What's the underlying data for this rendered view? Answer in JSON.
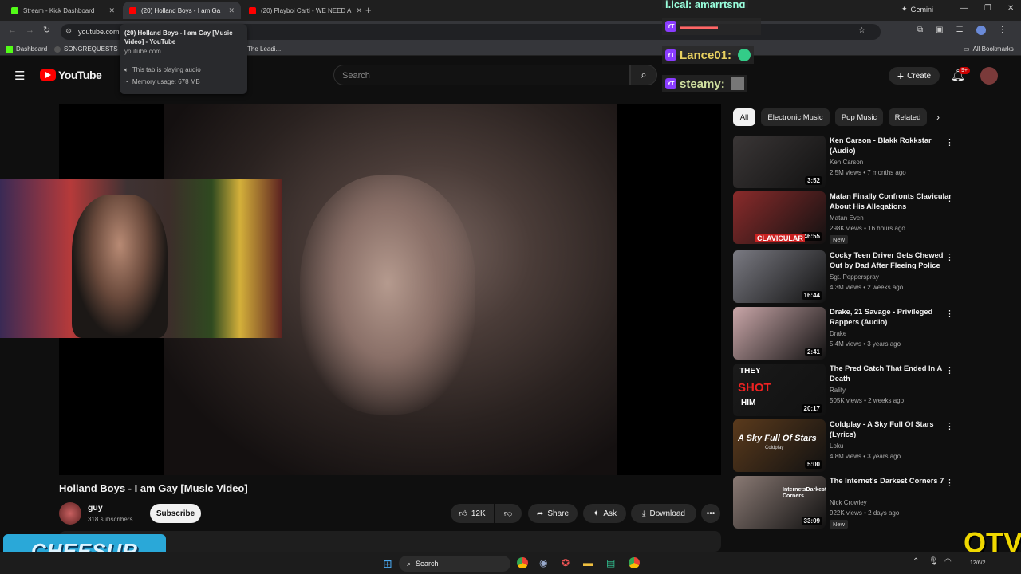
{
  "browser": {
    "tabs": [
      {
        "title": "Stream - Kick Dashboard",
        "favicon_color": "#53fc18"
      },
      {
        "title": "(20) Holland Boys - I am Ga",
        "favicon_color": "#ff0000"
      },
      {
        "title": "(20) Playboi Carti - WE NEED A",
        "favicon_color": "#ff0000"
      }
    ],
    "new_tab": "+",
    "gemini_label": "Gemini",
    "url": "youtube.com",
    "bookmarks": [
      "Dashboard",
      "SONGREQUESTS",
      "The Leadi..."
    ],
    "all_bookmarks": "All Bookmarks",
    "tooltip": {
      "title": "(20) Holland Boys - I am Gay [Music Video] - YouTube",
      "domain": "youtube.com",
      "audio": "This tab is playing audio",
      "memory": "Memory usage: 678 MB"
    }
  },
  "youtube": {
    "logo_text": "YouTube",
    "search_placeholder": "Search",
    "create_label": "Create",
    "notif_count": "9+",
    "chips": [
      "All",
      "Electronic Music",
      "Pop Music",
      "Related"
    ],
    "video_title": "Holland Boys - I am Gay [Music Video]",
    "channel_name": "guy",
    "subscribers": "318 subscribers",
    "subscribe_label": "Subscribe",
    "likes": "12K",
    "share_label": "Share",
    "ask_label": "Ask",
    "download_label": "Download"
  },
  "recommendations": [
    {
      "title": "Ken Carson - Blakk Rokkstar (Audio)",
      "channel": "Ken Carson",
      "meta": "2.5M views • 7 months ago",
      "duration": "3:52",
      "new": "",
      "thumb_color": "#3a3636"
    },
    {
      "title": "Matan Finally Confronts Clavicular About His Allegations",
      "channel": "Matan Even",
      "meta": "298K views • 16 hours ago",
      "duration": "46:55",
      "new": "New",
      "thumb_color": "#8a2b2b"
    },
    {
      "title": "Cocky Teen Driver Gets Chewed Out by Dad After Fleeing Police",
      "channel": "Sgt. Pepperspray",
      "meta": "4.3M views • 2 weeks ago",
      "duration": "16:44",
      "new": "",
      "thumb_color": "#7a7a82"
    },
    {
      "title": "Drake, 21 Savage - Privileged Rappers (Audio)",
      "channel": "Drake",
      "meta": "5.4M views • 3 years ago",
      "duration": "2:41",
      "new": "",
      "thumb_color": "#c9a6a8"
    },
    {
      "title": "The Pred Catch That Ended In A Death",
      "channel": "Ralify",
      "meta": "505K views • 2 weeks ago",
      "duration": "20:17",
      "new": "",
      "thumb_color": "#1a1a1a"
    },
    {
      "title": "Coldplay - A Sky Full Of Stars (Lyrics)",
      "channel": "Loku",
      "meta": "4.8M views • 3 years ago",
      "duration": "5:00",
      "new": "",
      "thumb_color": "#5a3a1c"
    },
    {
      "title": "The Internet's Darkest Corners 7",
      "channel": "Nick Crowley",
      "meta": "922K views • 2 days ago",
      "duration": "33:09",
      "new": "New",
      "thumb_color": "#8a7a74"
    }
  ],
  "thumb_texts": {
    "clavicular": "CLAVICULAR",
    "they": "THEY",
    "shot": "SHOT",
    "him": "HIM",
    "sky": "A Sky Full Of Stars",
    "sky_sub": "Coldplay",
    "internet": "InternetsDarkest Corners"
  },
  "overlay": {
    "chat": [
      {
        "name": "Lance01:",
        "color": "#e8d060"
      },
      {
        "name": "steamy:",
        "color": "#d0e0a0"
      }
    ],
    "chat_top": "j.ical: amarrtsng",
    "cheesur": "CHEESUR",
    "corner_logo": "OTV"
  },
  "taskbar": {
    "search": "Search",
    "date": "12/6/2..."
  }
}
